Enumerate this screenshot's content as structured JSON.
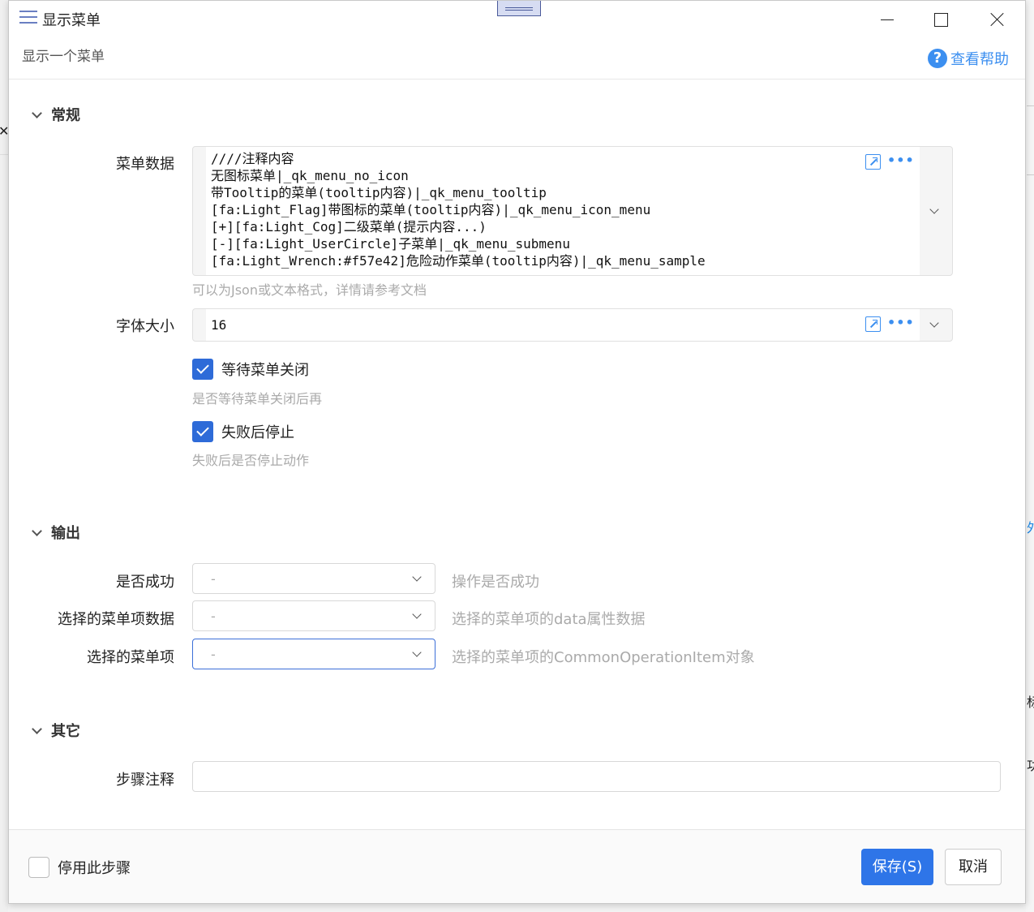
{
  "window": {
    "title": "显示菜单",
    "subtitle": "显示一个菜单",
    "help_label": "查看帮助"
  },
  "sections": {
    "general": {
      "title": "常规"
    },
    "output": {
      "title": "输出"
    },
    "other": {
      "title": "其它"
    }
  },
  "general": {
    "menu_data": {
      "label": "菜单数据",
      "value": "////注释内容\n无图标菜单|_qk_menu_no_icon\n带Tooltip的菜单(tooltip内容)|_qk_menu_tooltip\n[fa:Light_Flag]带图标的菜单(tooltip内容)|_qk_menu_icon_menu\n[+][fa:Light_Cog]二级菜单(提示内容...)\n[-][fa:Light_UserCircle]子菜单|_qk_menu_submenu\n[fa:Light_Wrench:#f57e42]危险动作菜单(tooltip内容)|_qk_menu_sample",
      "hint": "可以为Json或文本格式，详情请参考文档"
    },
    "font_size": {
      "label": "字体大小",
      "value": "16"
    },
    "wait_close": {
      "label": "等待菜单关闭",
      "checked": true,
      "hint": "是否等待菜单关闭后再"
    },
    "stop_on_fail": {
      "label": "失败后停止",
      "checked": true,
      "hint": "失败后是否停止动作"
    }
  },
  "output": {
    "success": {
      "label": "是否成功",
      "value": "-",
      "desc": "操作是否成功"
    },
    "item_data": {
      "label": "选择的菜单项数据",
      "value": "-",
      "desc": "选择的菜单项的data属性数据"
    },
    "item": {
      "label": "选择的菜单项",
      "value": "-",
      "desc": "选择的菜单项的CommonOperationItem对象"
    }
  },
  "other": {
    "step_note": {
      "label": "步骤注释",
      "value": ""
    }
  },
  "footer": {
    "disable_label": "停用此步骤",
    "disable_checked": false,
    "save_label": "保存(S)",
    "cancel_label": "取消"
  },
  "background": {
    "right_fragments": [
      "外",
      "标",
      "功"
    ]
  },
  "colors": {
    "accent": "#2e75e8",
    "link": "#3c8ff0",
    "checkbox": "#2e6bd8"
  }
}
